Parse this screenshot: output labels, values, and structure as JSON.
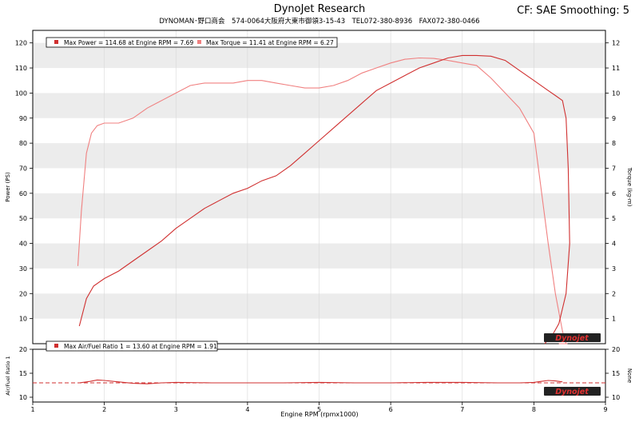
{
  "header": {
    "title": "DynoJet Research",
    "subtitle": "DYNOMAN･野口商会　574-0064大阪府大東市御領3-15-43　TEL072-380-8936　FAX072-380-0466",
    "cf": "CF: SAE Smoothing: 5"
  },
  "legend": {
    "power": "Max Power = 114.68 at Engine RPM = 7.69",
    "torque": "Max Torque = 11.41 at Engine RPM = 6.27",
    "afr": "Max Air/Fuel Ratio 1 = 13.60 at Engine RPM = 1.91"
  },
  "watermark": "Dynojet",
  "colors": {
    "power": "#d03030",
    "torque": "#f08080",
    "afr": "#d03030",
    "band": "#ececec"
  },
  "chart_data": [
    {
      "type": "line",
      "xlabel": "Engine RPM (rpmx1000)",
      "ylabel": "Power (PS)",
      "y2label": "Torque (kg-m)",
      "xlim": [
        1,
        9
      ],
      "ylim": [
        0,
        125
      ],
      "y2lim": [
        0,
        12.5
      ],
      "xticks": [
        "1",
        "2",
        "3",
        "4",
        "5",
        "6",
        "7",
        "8",
        "9"
      ],
      "yticks": [
        "10",
        "20",
        "30",
        "40",
        "50",
        "60",
        "70",
        "80",
        "90",
        "100",
        "110",
        "120"
      ],
      "y2ticks": [
        "1",
        "2",
        "3",
        "4",
        "5",
        "6",
        "7",
        "8",
        "9",
        "10",
        "11",
        "12"
      ],
      "grid": true,
      "legend_position": "top-left",
      "series": [
        {
          "name": "Power",
          "axis": "left",
          "x": [
            1.65,
            1.75,
            1.85,
            2.0,
            2.2,
            2.4,
            2.6,
            2.8,
            3.0,
            3.2,
            3.4,
            3.6,
            3.8,
            4.0,
            4.2,
            4.4,
            4.6,
            4.8,
            5.0,
            5.2,
            5.4,
            5.6,
            5.8,
            6.0,
            6.2,
            6.4,
            6.6,
            6.8,
            7.0,
            7.2,
            7.4,
            7.6,
            7.8,
            8.0,
            8.2,
            8.3,
            8.4,
            8.45,
            8.48,
            8.5,
            8.45,
            8.35,
            8.25,
            8.15
          ],
          "y": [
            7,
            18,
            23,
            26,
            29,
            33,
            37,
            41,
            46,
            50,
            54,
            57,
            60,
            62,
            65,
            67,
            71,
            76,
            81,
            86,
            91,
            96,
            101,
            104,
            107,
            110,
            112,
            114,
            115,
            115,
            114.7,
            113,
            109,
            105,
            101,
            99,
            97,
            90,
            70,
            40,
            20,
            8,
            3,
            0
          ]
        },
        {
          "name": "Torque",
          "axis": "right",
          "x": [
            1.63,
            1.68,
            1.75,
            1.82,
            1.9,
            2.0,
            2.1,
            2.2,
            2.4,
            2.6,
            2.8,
            3.0,
            3.2,
            3.4,
            3.6,
            3.8,
            4.0,
            4.2,
            4.4,
            4.6,
            4.8,
            5.0,
            5.2,
            5.4,
            5.6,
            5.8,
            6.0,
            6.2,
            6.4,
            6.6,
            6.8,
            7.0,
            7.2,
            7.4,
            7.6,
            7.8,
            8.0,
            8.2,
            8.3,
            8.4,
            8.45,
            8.47,
            8.45,
            8.4,
            8.35
          ],
          "y": [
            3.1,
            5.3,
            7.6,
            8.4,
            8.7,
            8.8,
            8.8,
            8.8,
            9.0,
            9.4,
            9.7,
            10.0,
            10.3,
            10.4,
            10.4,
            10.4,
            10.5,
            10.5,
            10.4,
            10.3,
            10.2,
            10.2,
            10.3,
            10.5,
            10.8,
            11.0,
            11.2,
            11.35,
            11.4,
            11.38,
            11.3,
            11.2,
            11.1,
            10.6,
            10.0,
            9.4,
            8.4,
            4.0,
            2.0,
            0.5,
            0.0,
            0.0,
            0.0,
            0.0,
            0.0
          ]
        }
      ]
    },
    {
      "type": "line",
      "xlabel": "Engine RPM (rpmx1000)",
      "ylabel": "Air/Fuel Ratio 1",
      "y2label": "None",
      "xlim": [
        1,
        9
      ],
      "ylim": [
        9,
        20
      ],
      "yticks": [
        "10",
        "15",
        "20"
      ],
      "y2ticks": [
        "10",
        "15",
        "20"
      ],
      "reference_line": 13,
      "series": [
        {
          "name": "Air/Fuel Ratio 1",
          "x": [
            1.65,
            1.8,
            1.9,
            2.0,
            2.2,
            2.4,
            2.6,
            2.8,
            3.0,
            3.5,
            4.0,
            4.5,
            5.0,
            5.5,
            6.0,
            6.5,
            7.0,
            7.5,
            7.8,
            8.0,
            8.1,
            8.2,
            8.3,
            8.4
          ],
          "y": [
            13.0,
            13.3,
            13.6,
            13.5,
            13.2,
            12.9,
            12.8,
            13.0,
            13.1,
            13.0,
            13.0,
            13.0,
            13.1,
            13.0,
            13.0,
            13.1,
            13.1,
            13.0,
            13.0,
            13.1,
            13.3,
            13.5,
            13.4,
            13.2
          ]
        }
      ]
    }
  ]
}
